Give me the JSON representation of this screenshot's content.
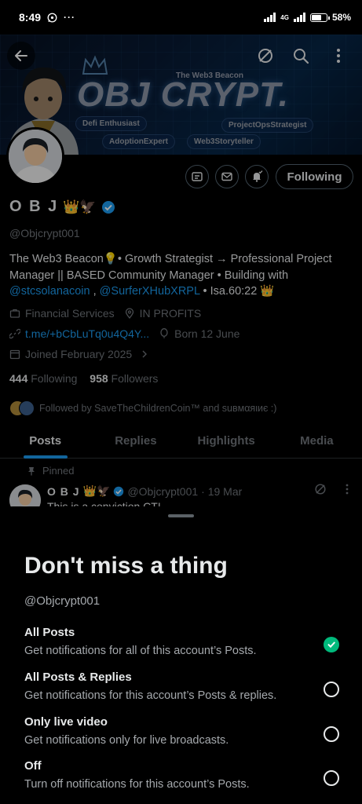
{
  "status_bar": {
    "time": "8:49",
    "net_label": "4G",
    "battery": "58%",
    "battery_level": 0.58
  },
  "banner": {
    "brand_title": "OBJ CRYPT.",
    "brand_subtitle": "The Web3 Beacon",
    "tags": [
      "Defi Enthusiast",
      "ProjectOpsStrategist",
      "AdoptionExpert",
      "Web3Storyteller"
    ]
  },
  "profile": {
    "name": "O B J",
    "name_emoji": "👑🦅",
    "handle": "@Objcrypt001",
    "following_button": "Following",
    "bio_text": "The Web3 Beacon💡• Growth Strategist → Professional Project Manager || BASED Community Manager • Building with ",
    "bio_mention_1": "@stcsolanacoin",
    "bio_sep": " , ",
    "bio_mention_2": "@SurferXHubXRPL",
    "bio_tail": " • Isa.60:22 👑",
    "category": "Financial Services",
    "location": "IN PROFITS",
    "link": "t.me/+bCbLuTq0u4Q4Y...",
    "born": "Born 12 June",
    "joined": "Joined February 2025",
    "following_count": "444",
    "following_label": "Following",
    "followers_count": "958",
    "followers_label": "Followers",
    "followed_by": "Followed by SaveTheChildrenCoin™ and suʙмαяιиє :)"
  },
  "tabs": [
    "Posts",
    "Replies",
    "Highlights",
    "Media"
  ],
  "pinned_post": {
    "pinned_label": "Pinned",
    "author_name": "O B J",
    "author_emoji": "👑🦅",
    "author_handle": "@Objcrypt001",
    "date": "· 19 Mar",
    "text": "This is a conviction CT!"
  },
  "sheet": {
    "title": "Don't miss a thing",
    "handle": "@Objcrypt001",
    "options": [
      {
        "title": "All Posts",
        "desc": "Get notifications for all of this account’s Posts.",
        "checked": true
      },
      {
        "title": "All Posts & Replies",
        "desc": "Get notifications for this account’s Posts & replies.",
        "checked": false
      },
      {
        "title": "Only live video",
        "desc": "Get notifications only for live broadcasts.",
        "checked": false
      },
      {
        "title": "Off",
        "desc": "Turn off notifications for this account’s Posts.",
        "checked": false
      }
    ]
  },
  "colors": {
    "accent": "#1d9bf0",
    "check": "#00ba7c",
    "muted": "#71767b"
  }
}
